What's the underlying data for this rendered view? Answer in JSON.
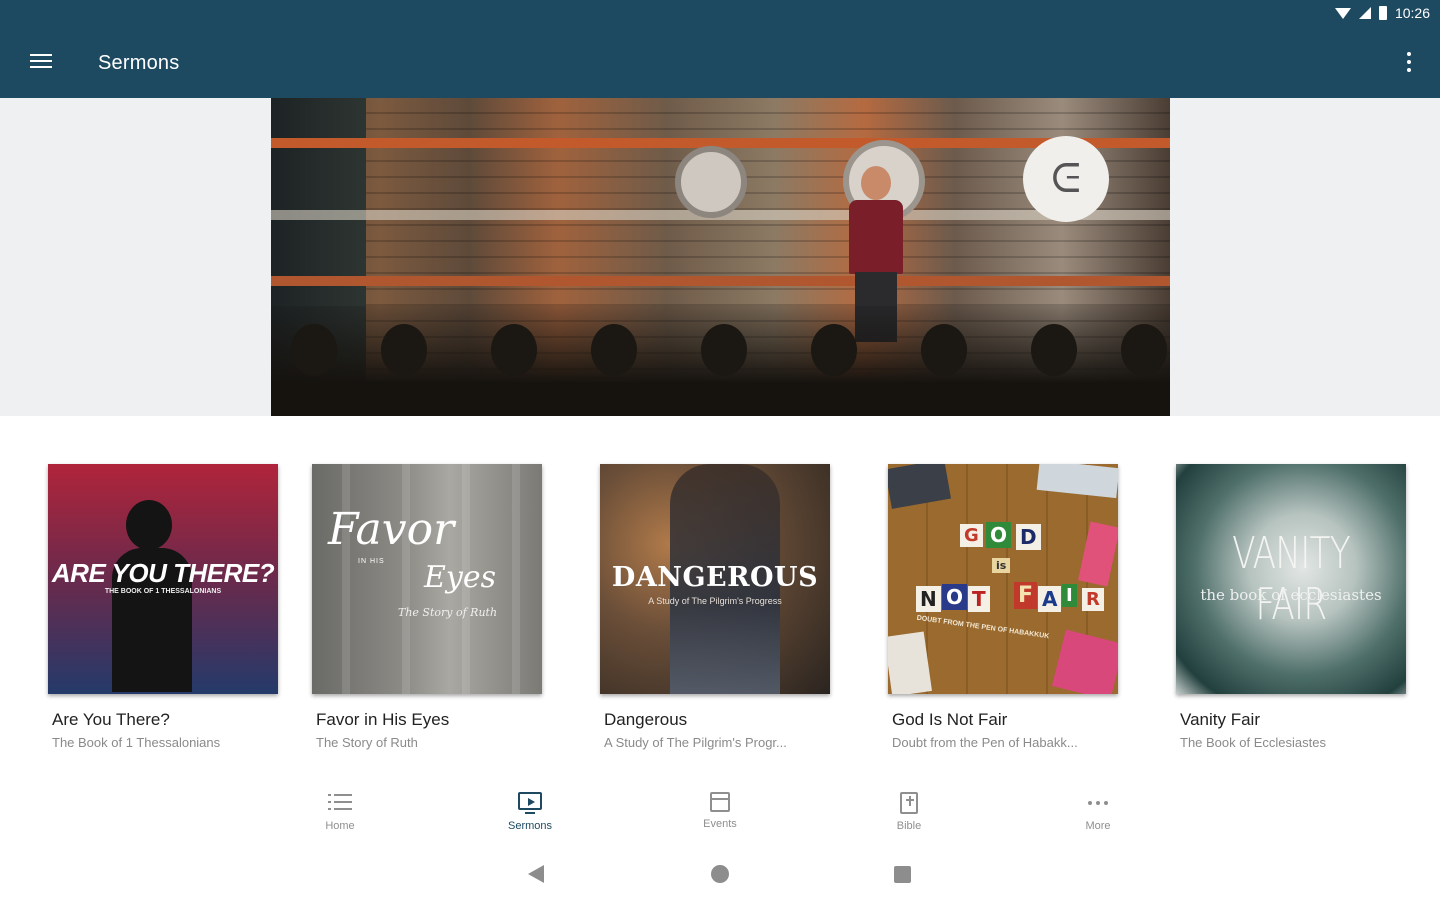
{
  "status_bar": {
    "time": "10:26"
  },
  "app_bar": {
    "title": "Sermons"
  },
  "hero": {
    "logo_glyph": "ᕮ"
  },
  "sermons": [
    {
      "title": "Are You There?",
      "subtitle": "The Book of 1 Thessalonians",
      "art_title": "ARE YOU THERE?",
      "art_subtitle": "THE BOOK OF 1 THESSALONIANS"
    },
    {
      "title": "Favor in His Eyes",
      "subtitle": "The Story of Ruth",
      "art_title_1": "Favor",
      "art_small": "IN HIS",
      "art_title_2": "Eyes",
      "art_subtitle": "The Story of Ruth"
    },
    {
      "title": "Dangerous",
      "subtitle": "A Study of The Pilgrim's Progr...",
      "art_title": "DANGEROUS",
      "art_subtitle": "A Study of The Pilgrim's Progress"
    },
    {
      "title": "God Is Not Fair",
      "subtitle": "Doubt from the Pen of Habakk...",
      "art_letters": [
        "G",
        "O",
        "D",
        "is",
        "N",
        "O",
        "T",
        "F",
        "A",
        "I",
        "R"
      ],
      "art_subtitle": "DOUBT FROM THE PEN OF HABAKKUK"
    },
    {
      "title": "Vanity Fair",
      "subtitle": "The Book of Ecclesiastes",
      "art_title": "VANITY FAIR",
      "art_subtitle": "the book of ecclesiastes"
    }
  ],
  "bottom_nav": [
    {
      "label": "Home",
      "icon": "list-icon",
      "active": false
    },
    {
      "label": "Sermons",
      "icon": "sermon-screen-icon",
      "active": true
    },
    {
      "label": "Events",
      "icon": "calendar-icon",
      "active": false
    },
    {
      "label": "Bible",
      "icon": "bible-icon",
      "active": false
    },
    {
      "label": "More",
      "icon": "more-dots-icon",
      "active": false
    }
  ],
  "colors": {
    "app_bar": "#1d4a61",
    "active_nav": "#1d4a61",
    "inactive_nav": "#8f8f8f"
  }
}
